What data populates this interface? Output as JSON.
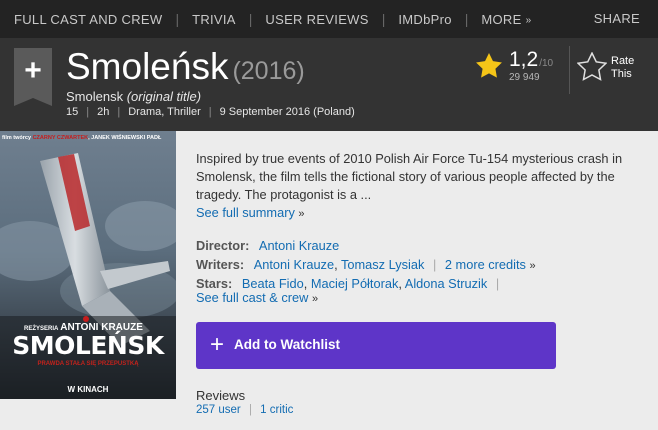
{
  "nav": {
    "full_cast": "FULL CAST AND CREW",
    "trivia": "TRIVIA",
    "user_reviews": "USER REVIEWS",
    "imdbpro": "IMDbPro",
    "more": "MORE",
    "share": "SHARE"
  },
  "title": {
    "name": "Smoleńsk",
    "year": "(2016)",
    "original_title": "Smolensk",
    "original_title_note": "(original title)",
    "certificate": "15",
    "runtime": "2h",
    "genres": "Drama, Thriller",
    "release": "9 September 2016 (Poland)"
  },
  "rating": {
    "value": "1,2",
    "best": "/10",
    "count": "29 949",
    "rate_label_1": "Rate",
    "rate_label_2": "This",
    "star_color": "#f5c518"
  },
  "poster": {
    "credits_prefix": "film twórcy",
    "credits_red": "CZARNY CZWARTEK",
    "credits_suffix": "JANEK WIŚNIEWSKI PADŁ",
    "director_prefix": "REŻYSERIA",
    "director_name": "ANTONI KRAUZE",
    "title": "SMOLEŃSK",
    "tagline": "PRAWDA STAŁA SIĘ PRZEPUSTKĄ",
    "cinema": "W KINACH"
  },
  "summary": {
    "text": "Inspired by true events of 2010 Polish Air Force Tu-154 mysterious crash in Smolensk, the film tells the fictional story of various people affected by the tragedy. The protagonist is a ...",
    "see_full": "See full summary"
  },
  "credits": {
    "director_label": "Director:",
    "director": "Antoni Krauze",
    "writers_label": "Writers:",
    "writers": [
      "Antoni Krauze",
      "Tomasz Lysiak"
    ],
    "writers_more": "2 more credits",
    "stars_label": "Stars:",
    "stars": [
      "Beata Fido",
      "Maciej Półtorak",
      "Aldona Struzik"
    ],
    "see_cast": "See full cast & crew"
  },
  "watchlist": {
    "label": "Add to Watchlist",
    "color": "#5e35c8"
  },
  "reviews": {
    "heading": "Reviews",
    "user": "257 user",
    "critic": "1 critic"
  },
  "colors": {
    "link": "#136cb2",
    "header_bg": "#333333",
    "nav_bg": "#232323"
  }
}
